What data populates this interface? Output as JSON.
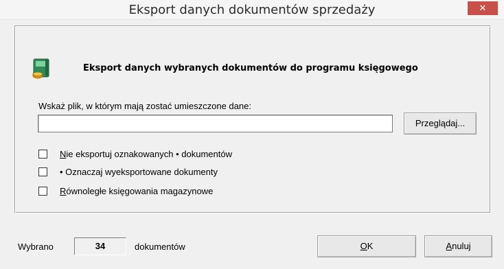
{
  "window": {
    "title": "Eksport danych dokumentów sprzedaży",
    "close_label": "✕"
  },
  "header": {
    "icon": "export-binder-icon",
    "text": "Eksport danych wybranych dokumentów do programu księgowego"
  },
  "file": {
    "label": "Wskaż plik, w którym mają zostać umieszczone dane:",
    "value": "",
    "browse_label": "Przeglądaj..."
  },
  "options": [
    {
      "mnemonic": "N",
      "label_rest": "ie eksportuj oznakowanych • dokumentów",
      "checked": false
    },
    {
      "mnemonic": "",
      "label_rest": "• Oznaczaj wyeksportowane dokumenty",
      "checked": false
    },
    {
      "mnemonic": "R",
      "label_rest": "ównoległe księgowania magazynowe",
      "checked": false
    }
  ],
  "status": {
    "prefix": "Wybrano",
    "count": "34",
    "suffix": "dokumentów"
  },
  "buttons": {
    "ok_mnemonic": "O",
    "ok_rest": "K",
    "cancel_mnemonic": "A",
    "cancel_rest": "nuluj"
  }
}
